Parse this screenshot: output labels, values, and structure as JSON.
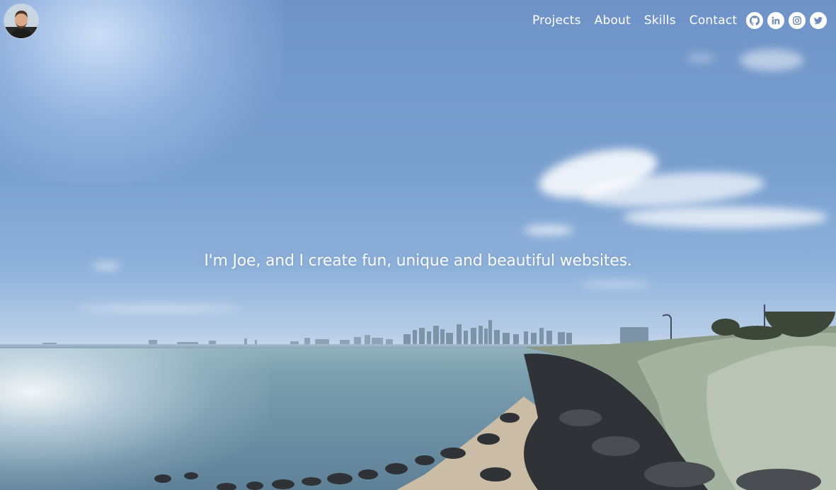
{
  "header": {
    "avatar_alt": "",
    "nav": [
      {
        "label": "Projects"
      },
      {
        "label": "About"
      },
      {
        "label": "Skills"
      },
      {
        "label": "Contact"
      }
    ],
    "social": [
      {
        "icon": "github-icon"
      },
      {
        "icon": "linkedin-icon"
      },
      {
        "icon": "instagram-icon"
      },
      {
        "icon": "twitter-icon"
      }
    ]
  },
  "hero": {
    "tagline": "I'm Joe, and I create fun, unique and beautiful websites."
  },
  "colors": {
    "sky": "#7aa0cf",
    "sea": "#6f93a6",
    "text": "#ffffff"
  }
}
